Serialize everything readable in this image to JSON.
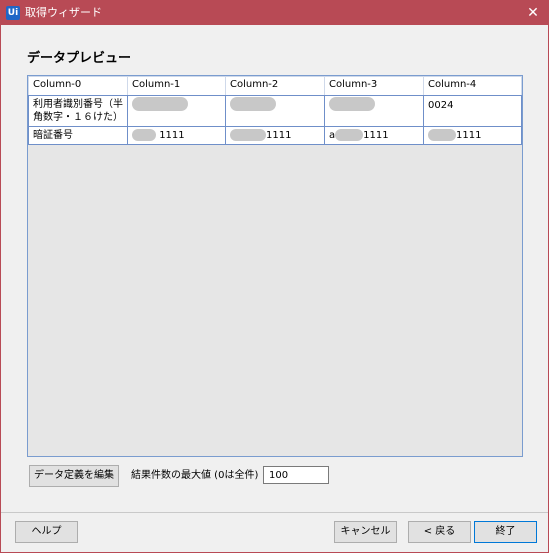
{
  "window": {
    "title": "取得ウィザード",
    "app_icon": "Ui",
    "close_glyph": "✕"
  },
  "preview": {
    "title": "データプレビュー",
    "columns": [
      "Column-0",
      "Column-1",
      "Column-2",
      "Column-3",
      "Column-4"
    ],
    "rows": [
      {
        "c0": "利用者識別番号（半角数字・１６けた）",
        "c1": "",
        "c2": "",
        "c3": "",
        "c4": "0024"
      },
      {
        "c0": "暗証番号",
        "c1": "1111",
        "c2": "1111",
        "c3": "1111",
        "c4": "1111",
        "c3_prefix": "a"
      }
    ]
  },
  "controls": {
    "edit_data_definition": "データ定義を編集",
    "max_results_label": "結果件数の最大値 (0は全件)",
    "max_results_value": "100"
  },
  "footer": {
    "help": "ヘルプ",
    "cancel": "キャンセル",
    "back": "< 戻る",
    "finish": "終了"
  },
  "colors": {
    "titlebar": "#b84a55",
    "grid_border": "#6f8fc9"
  }
}
